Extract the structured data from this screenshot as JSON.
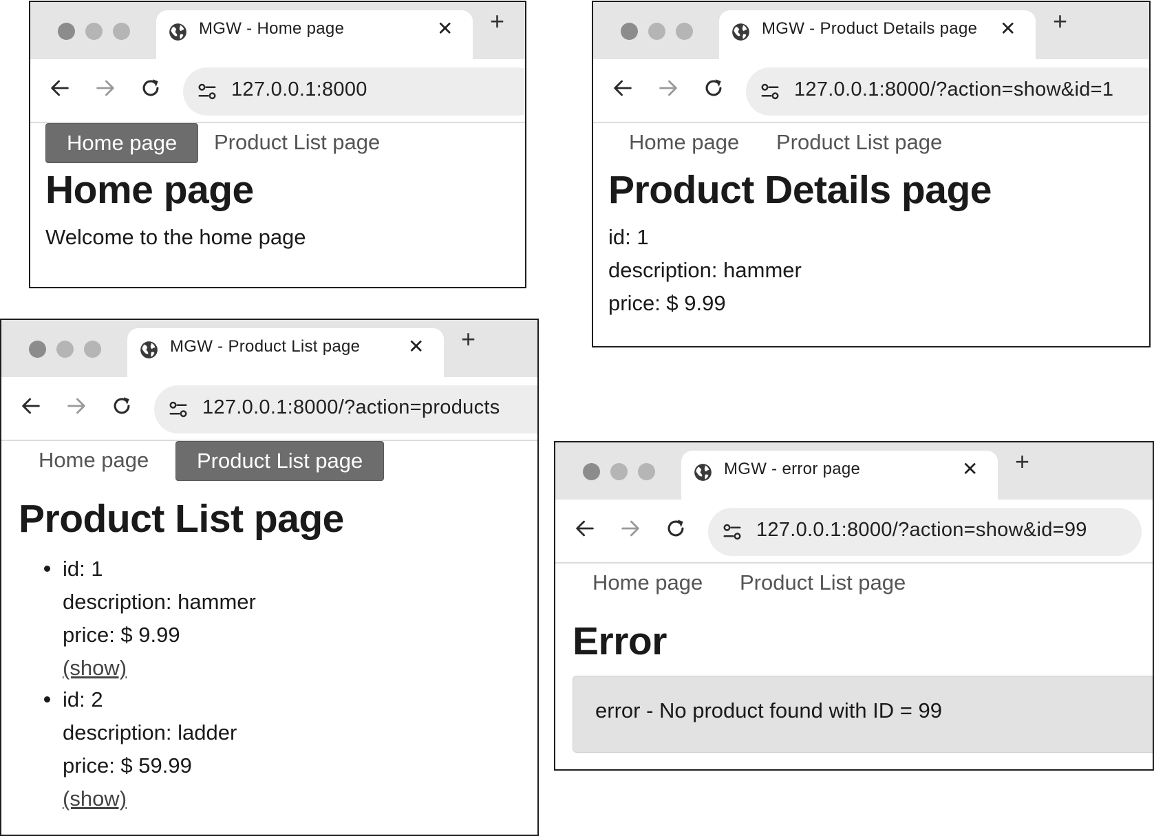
{
  "windows": {
    "home": {
      "tab_title": "MGW - Home page",
      "url": "127.0.0.1:8000",
      "nav": {
        "home": "Home page",
        "products": "Product List page"
      },
      "heading": "Home page",
      "text": "Welcome to the home page"
    },
    "details": {
      "tab_title": "MGW - Product Details page",
      "url": "127.0.0.1:8000/?action=show&id=1",
      "nav": {
        "home": "Home page",
        "products": "Product List page"
      },
      "heading": "Product Details page",
      "lines": [
        "id: 1",
        "description: hammer",
        "price: $ 9.99"
      ]
    },
    "list": {
      "tab_title": "MGW - Product List page",
      "url": "127.0.0.1:8000/?action=products",
      "nav": {
        "home": "Home page",
        "products": "Product List page"
      },
      "heading": "Product List page",
      "products": [
        {
          "id": "id: 1",
          "description": "description: hammer",
          "price": "price: $ 9.99",
          "link": "(show)"
        },
        {
          "id": "id: 2",
          "description": "description: ladder",
          "price": "price: $ 59.99",
          "link": "(show)"
        }
      ]
    },
    "error": {
      "tab_title": "MGW - error page",
      "url": "127.0.0.1:8000/?action=show&id=99",
      "nav": {
        "home": "Home page",
        "products": "Product List page"
      },
      "heading": "Error",
      "message": "error - No product found with ID = 99"
    }
  },
  "browser": {
    "new_tab": "+",
    "close": "✕"
  },
  "colors": {
    "active_nav": "#6d6d6d",
    "tabbar": "#e5e5e5",
    "omnibox": "#ededed",
    "error_box": "#e2e2e2"
  }
}
